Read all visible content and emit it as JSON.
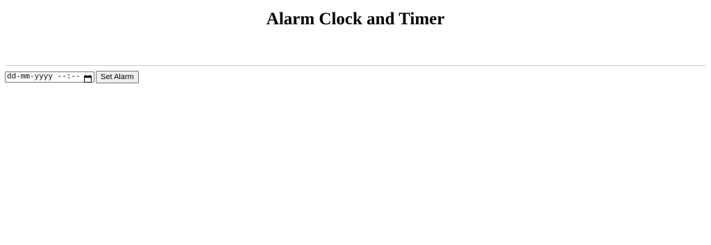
{
  "page": {
    "title": "Alarm Clock and Timer"
  },
  "alarm": {
    "input_placeholder_text": "dd-mm-yyyy --:--",
    "calendar_icon": "calendar-icon",
    "set_button_label": "Set Alarm"
  }
}
